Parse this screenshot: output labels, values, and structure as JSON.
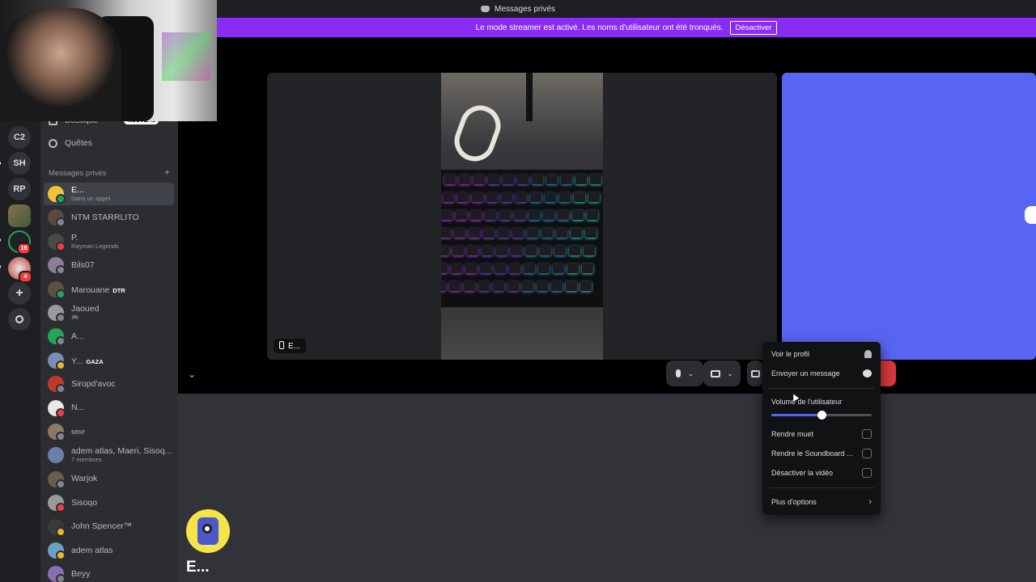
{
  "titlebar": {
    "title": "Messages privés"
  },
  "banner": {
    "text": "Le mode streamer est activé. Les noms d'utilisateur ont été tronqués.",
    "button": "Désactiver"
  },
  "rail": {
    "servers": [
      {
        "label": "C2",
        "unread": false,
        "badge": ""
      },
      {
        "label": "SH",
        "unread": true,
        "badge": ""
      },
      {
        "label": "RP",
        "unread": false,
        "badge": ""
      },
      {
        "label": "",
        "unread": false,
        "badge": ""
      },
      {
        "label": "",
        "unread": true,
        "badge": "19"
      },
      {
        "label": "",
        "unread": true,
        "badge": "4"
      }
    ],
    "add_icon": "plus-icon",
    "discover_icon": "compass-icon"
  },
  "sidebar": {
    "boutique": {
      "label": "Boutique",
      "tag": "NOUVEAU"
    },
    "quetes": {
      "label": "Quêtes"
    },
    "dm_header": "Messages privés",
    "dm_header_add": "+",
    "dms": [
      {
        "name": "E...",
        "sub": "Dans un appel",
        "status": "#23a55a",
        "avatar": "#f0c43a",
        "active": true,
        "tag": ""
      },
      {
        "name": "NTM STARRLITO",
        "sub": "",
        "status": "#80848e",
        "avatar": "#5a4a40",
        "active": false,
        "tag": ""
      },
      {
        "name": "P.",
        "sub": "Rayman Legends",
        "status": "#f23f43",
        "avatar": "#4a4a4a",
        "active": false,
        "tag": ""
      },
      {
        "name": "Bils07",
        "sub": "",
        "status": "#80848e",
        "avatar": "#8b7d9a",
        "active": false,
        "tag": ""
      },
      {
        "name": "Marouane",
        "sub": "",
        "status": "#23a55a",
        "avatar": "#5c5243",
        "active": false,
        "tag": "DTR"
      },
      {
        "name": "Jaoued",
        "sub": "🎮",
        "status": "#80848e",
        "avatar": "#9a9a9a",
        "active": false,
        "tag": ""
      },
      {
        "name": "A...",
        "sub": "",
        "status": "#80848e",
        "avatar": "#23a55a",
        "active": false,
        "tag": ""
      },
      {
        "name": "Y...",
        "sub": "",
        "status": "#f0b232",
        "avatar": "#7a8fb8",
        "active": false,
        "tag": "GAZA"
      },
      {
        "name": "Siropd'avoc",
        "sub": "",
        "status": "#80848e",
        "avatar": "#c0392b",
        "active": false,
        "tag": ""
      },
      {
        "name": "N...",
        "sub": "",
        "status": "#f23f43",
        "avatar": "#e8e8e8",
        "active": false,
        "tag": ""
      },
      {
        "name": "𝔰𝔞𝔰𝔬",
        "sub": "",
        "status": "#80848e",
        "avatar": "#8a7a66",
        "active": false,
        "tag": ""
      },
      {
        "name": "adem atlas, Maeri, Sisoq...",
        "sub": "7 membres",
        "status": "",
        "avatar": "#6d7fa8",
        "active": false,
        "tag": ""
      },
      {
        "name": "Warjok",
        "sub": "",
        "status": "#80848e",
        "avatar": "#6b5c4e",
        "active": false,
        "tag": ""
      },
      {
        "name": "Sisoqo",
        "sub": "",
        "status": "#f23f43",
        "avatar": "#9a9a9a",
        "active": false,
        "tag": ""
      },
      {
        "name": "John Spencer™",
        "sub": "",
        "status": "#f0b232",
        "avatar": "#3a3a3a",
        "active": false,
        "tag": ""
      },
      {
        "name": "adem atlas",
        "sub": "",
        "status": "#f0b232",
        "avatar": "#6d9ec4",
        "active": false,
        "tag": ""
      },
      {
        "name": "Beyy",
        "sub": "",
        "status": "#80848e",
        "avatar": "#8a6fb0",
        "active": false,
        "tag": ""
      }
    ]
  },
  "call": {
    "tile_label": "E...",
    "controls": {
      "mic_icon": "microphone-icon",
      "camera_icon": "camera-off-icon",
      "screen_icon": "screen-share-icon"
    }
  },
  "profile": {
    "name": "E..."
  },
  "context_menu": {
    "view_profile": "Voir le profil",
    "send_message": "Envoyer un message",
    "volume_label": "Volume de l'utilisateur",
    "volume_level": 0.5,
    "mute": "Rendre muet",
    "mute_soundboard": "Rendre le Soundboard ...",
    "disable_video": "Désactiver la vidéo",
    "more_options": "Plus d'options"
  },
  "colors": {
    "banner": "#8b2cf5",
    "accent": "#5865f2",
    "danger": "#da373c"
  }
}
